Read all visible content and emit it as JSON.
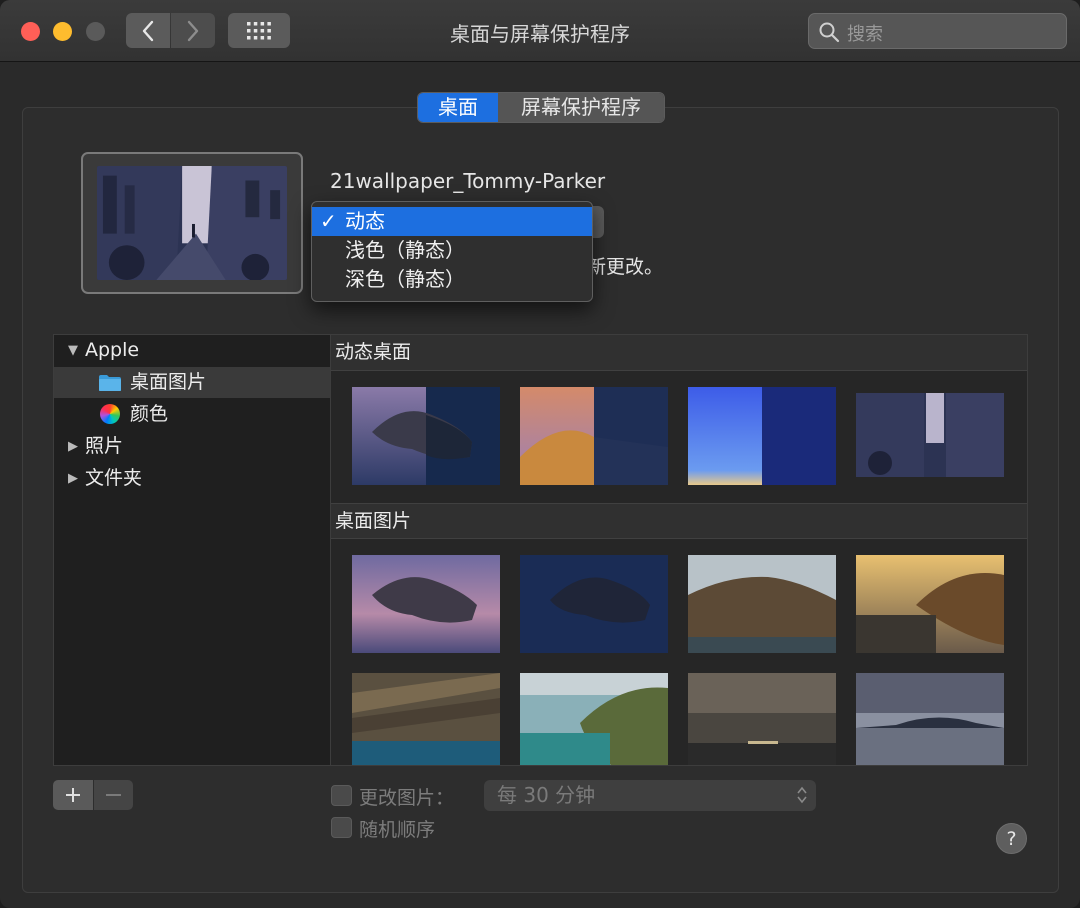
{
  "window": {
    "title": "桌面与屏幕保护程序"
  },
  "search": {
    "placeholder": "搜索"
  },
  "tabs": [
    {
      "label": "桌面",
      "active": true
    },
    {
      "label": "屏幕保护程序",
      "active": false
    }
  ],
  "wallpaper": {
    "name": "21wallpaper_Tommy-Parker",
    "hint_partial": "新更改。"
  },
  "appearance_menu": {
    "items": [
      {
        "label": "动态",
        "selected": true
      },
      {
        "label": "浅色（静态）",
        "selected": false
      },
      {
        "label": "深色（静态）",
        "selected": false
      }
    ]
  },
  "sidebar": {
    "items": [
      {
        "label": "Apple",
        "expanded": true,
        "icon": "disclosure-down"
      },
      {
        "label": "桌面图片",
        "icon": "folder-icon",
        "selected": true
      },
      {
        "label": "颜色",
        "icon": "color-wheel-icon"
      },
      {
        "label": "照片",
        "expanded": false,
        "icon": "disclosure-right"
      },
      {
        "label": "文件夹",
        "expanded": false,
        "icon": "disclosure-right"
      }
    ]
  },
  "grid": {
    "sections": [
      {
        "title": "动态桌面",
        "thumbs": [
          "catalina-dynamic",
          "mojave-dynamic",
          "blue-gradient-dynamic",
          "tommy-parker-dynamic"
        ]
      },
      {
        "title": "桌面图片",
        "thumbs": [
          "catalina-evening",
          "catalina-night",
          "catalina-coast-day",
          "catalina-cliff-sunset",
          "rock-strata",
          "island-coast",
          "sea-clouds",
          "island-dusk"
        ]
      }
    ]
  },
  "bottom": {
    "change_picture_label": "更改图片：",
    "interval_value": "每 30 分钟",
    "random_order_label": "随机顺序",
    "help_label": "?"
  },
  "colors": {
    "accent": "#1d6fe0",
    "close": "#ff5f57",
    "minimize": "#febc2e"
  }
}
